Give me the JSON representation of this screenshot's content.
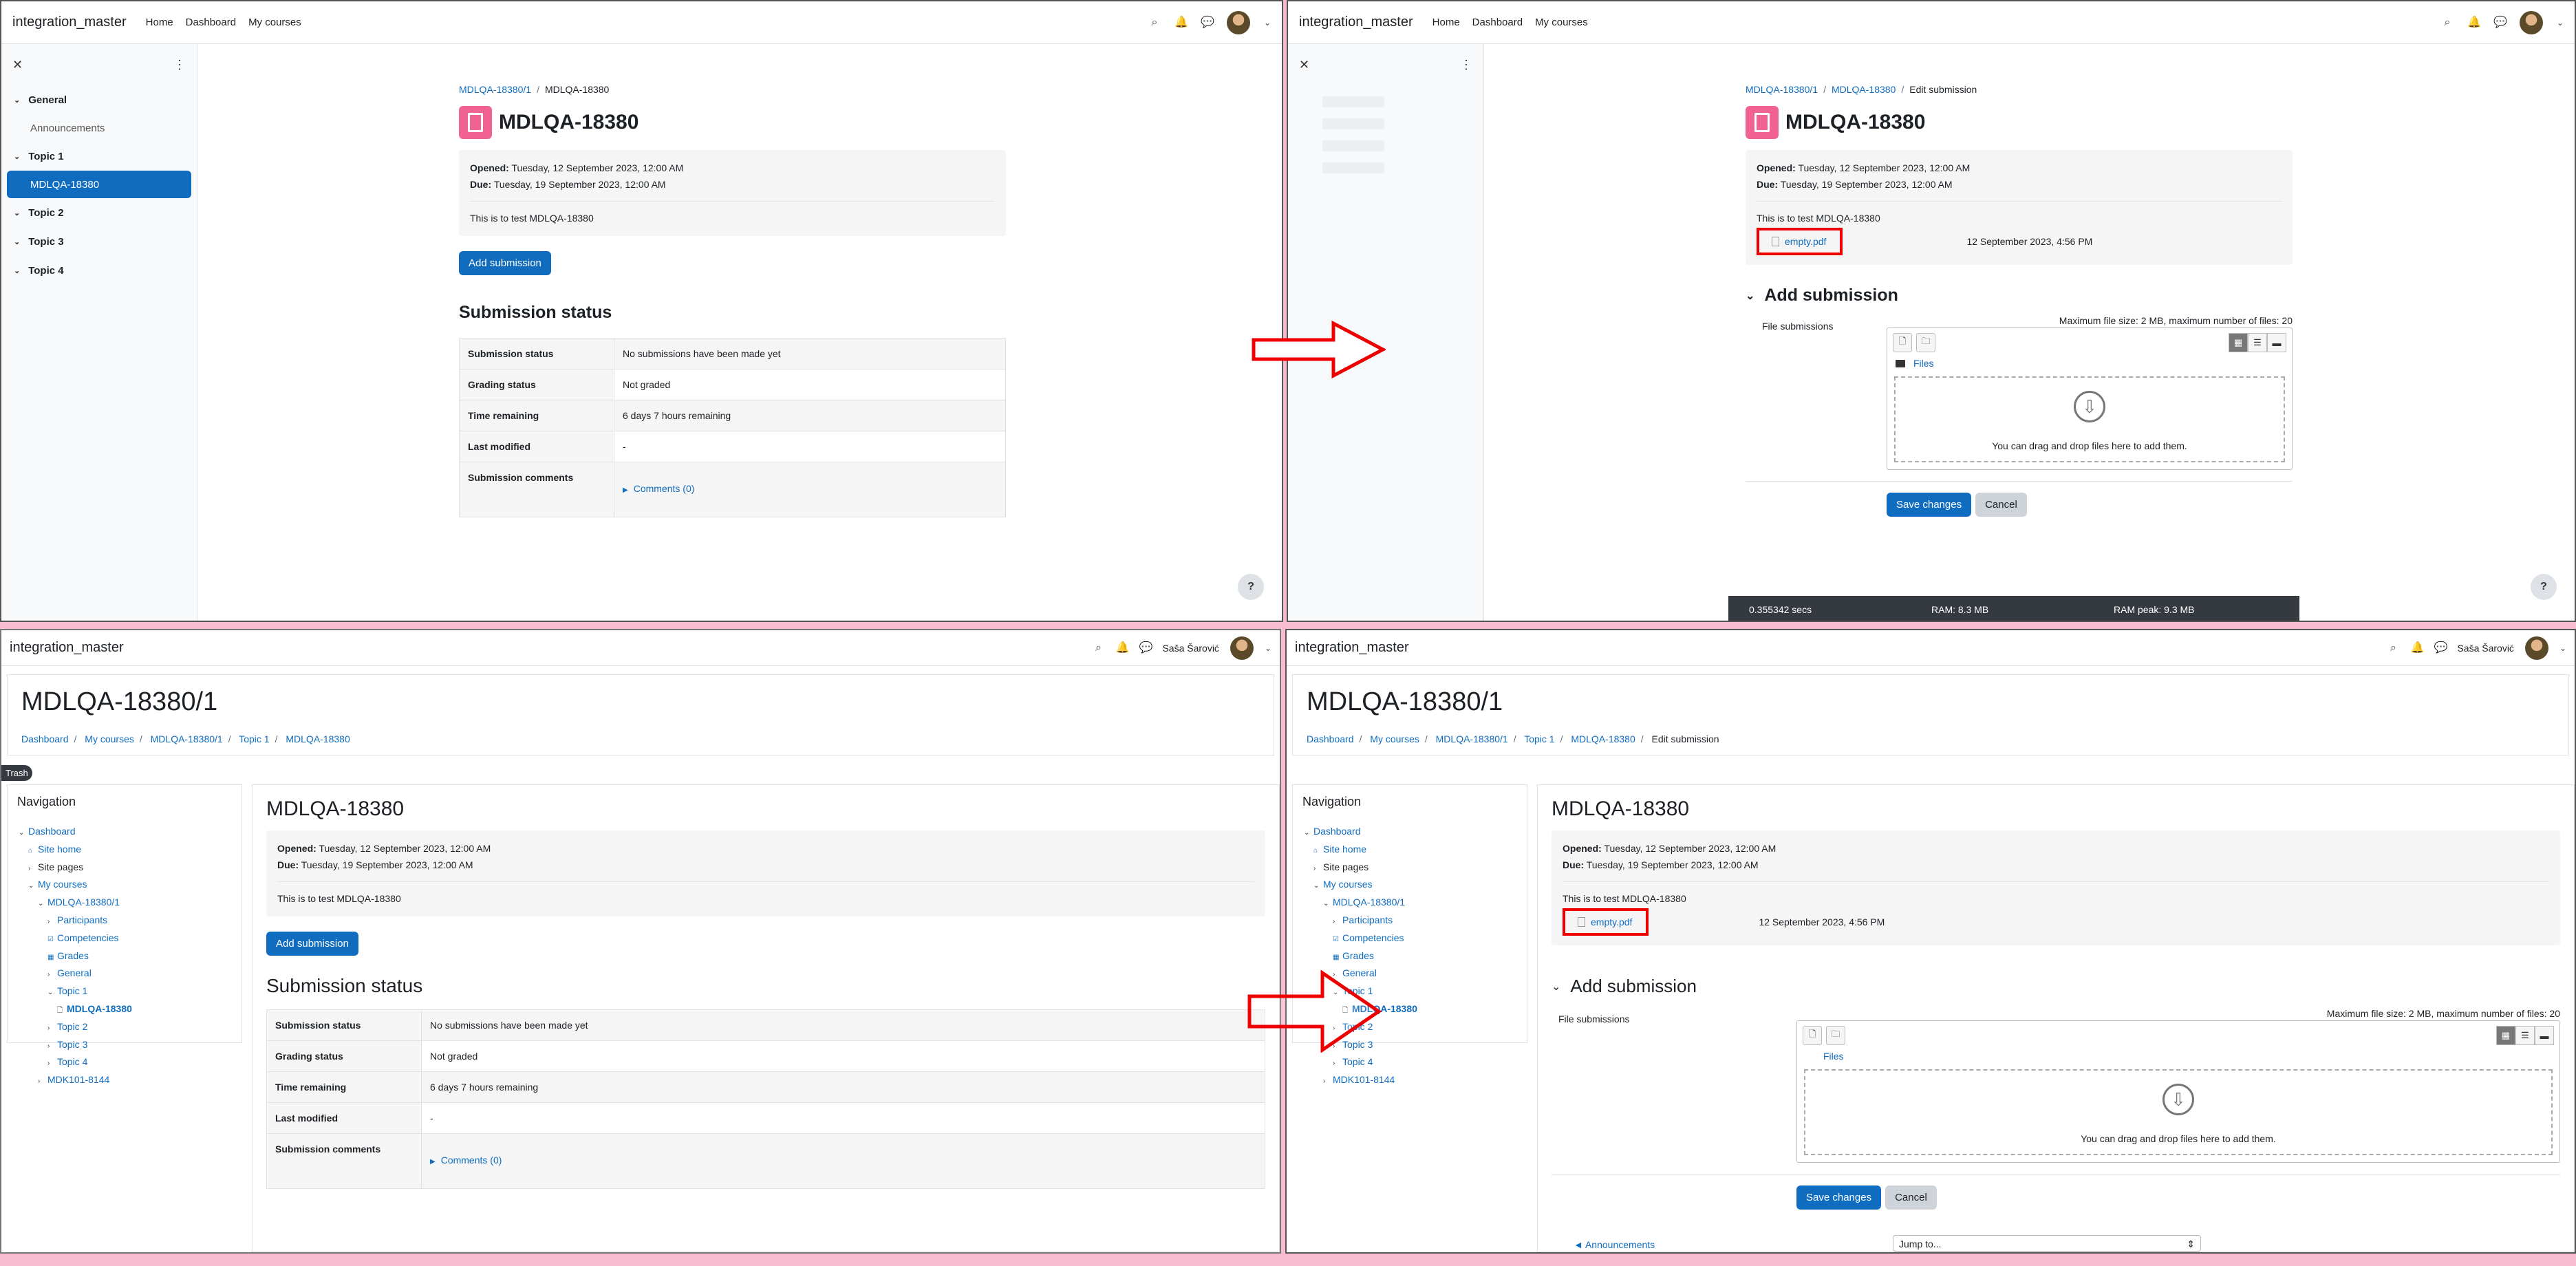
{
  "site": {
    "brand": "integration_master",
    "nav_home": "Home",
    "nav_dashboard": "Dashboard",
    "nav_mycourses": "My courses",
    "user_name": "Saša Šarović"
  },
  "drawer": {
    "general": "General",
    "announcements": "Announcements",
    "topic1": "Topic 1",
    "activity": "MDLQA-18380",
    "topic2": "Topic 2",
    "topic3": "Topic 3",
    "topic4": "Topic 4"
  },
  "assignment": {
    "title": "MDLQA-18380",
    "course_short": "MDLQA-18380/1",
    "opened_label": "Opened:",
    "opened_value": "Tuesday, 12 September 2023, 12:00 AM",
    "due_label": "Due:",
    "due_value": "Tuesday, 19 September 2023, 12:00 AM",
    "description": "This is to test MDLQA-18380",
    "add_submission_button": "Add submission",
    "edit_submission_crumb": "Edit submission",
    "attachment_name": "empty.pdf",
    "attachment_date": "12 September 2023, 4:56 PM"
  },
  "status": {
    "heading": "Submission status",
    "rows": [
      {
        "label": "Submission status",
        "value": "No submissions have been made yet"
      },
      {
        "label": "Grading status",
        "value": "Not graded"
      },
      {
        "label": "Time remaining",
        "value": "6 days 7 hours remaining"
      },
      {
        "label": "Last modified",
        "value": "-"
      },
      {
        "label": "Submission comments",
        "value": "Comments (0)"
      }
    ]
  },
  "form": {
    "section_title": "Add submission",
    "field_label": "File submissions",
    "limits": "Maximum file size: 2 MB, maximum number of files: 20",
    "files_path": "Files",
    "drop_text": "You can drag and drop files here to add them.",
    "save_button": "Save changes",
    "cancel_button": "Cancel"
  },
  "perf": {
    "secs": "0.355342 secs",
    "ram": "RAM: 8.3 MB",
    "ram_peak": "RAM peak: 9.3 MB"
  },
  "classic": {
    "page_title": "MDLQA-18380/1",
    "crumb_dashboard": "Dashboard",
    "crumb_mycourses": "My courses",
    "crumb_course": "MDLQA-18380/1",
    "crumb_topic": "Topic 1",
    "crumb_activity": "MDLQA-18380",
    "trash_label": "Trash",
    "nav_block_title": "Navigation",
    "tree": {
      "dashboard": "Dashboard",
      "site_home": "Site home",
      "site_pages": "Site pages",
      "my_courses": "My courses",
      "course": "MDLQA-18380/1",
      "participants": "Participants",
      "competencies": "Competencies",
      "grades": "Grades",
      "general": "General",
      "topic1": "Topic 1",
      "activity": "MDLQA-18380",
      "topic2": "Topic 2",
      "topic3": "Topic 3",
      "topic4": "Topic 4",
      "other_course": "MDK101-8144"
    },
    "announcements_link": "◄ Announcements",
    "jump_to": "Jump to..."
  },
  "colors": {
    "primary": "#0f6cbf",
    "assignment_icon": "#f06292",
    "highlight": "#e00000",
    "collage_background": "#f8bbd0"
  }
}
